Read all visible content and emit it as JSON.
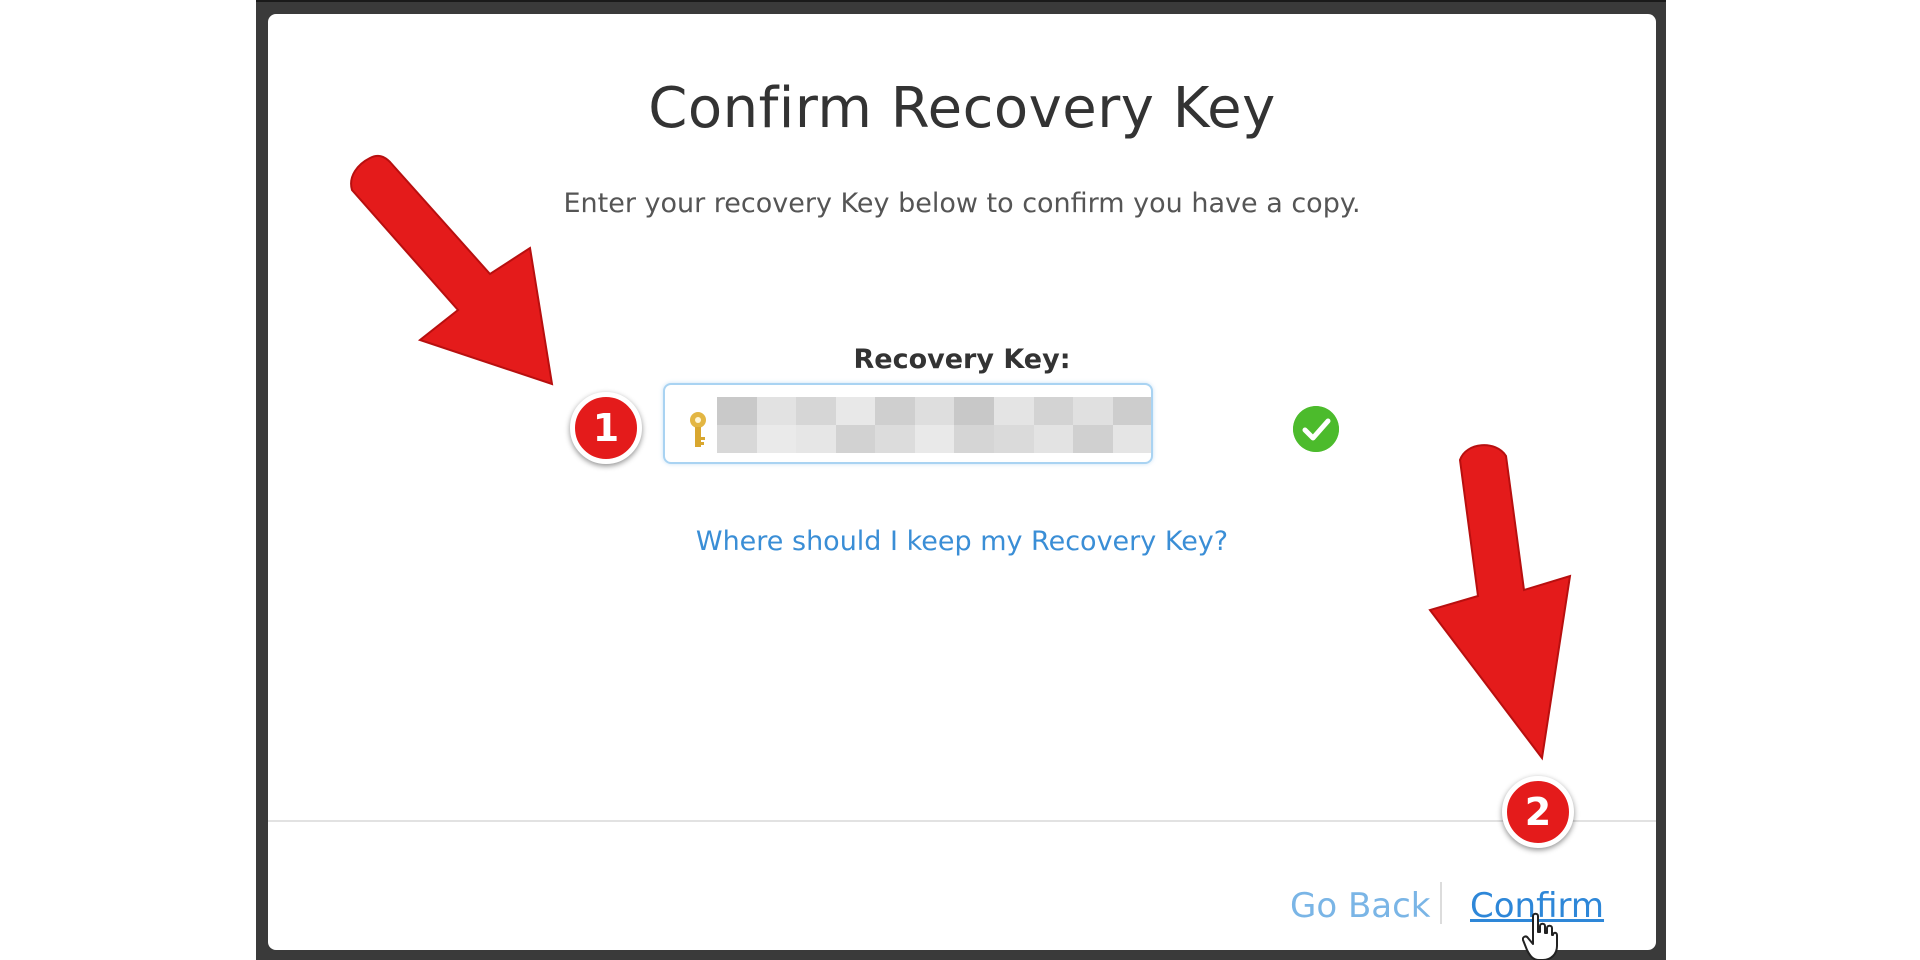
{
  "dialog": {
    "title": "Confirm Recovery Key",
    "subtitle": "Enter your recovery Key below to confirm you have a copy.",
    "field_label": "Recovery Key:",
    "key_icon": "key-icon",
    "valid_icon": "checkmark-icon",
    "help_link": "Where should I keep my Recovery Key?"
  },
  "footer": {
    "back_label": "Go Back",
    "confirm_label": "Confirm",
    "cursor_icon": "hand-pointer-icon"
  },
  "annotations": {
    "step1": "1",
    "step2": "2"
  },
  "colors": {
    "link": "#3a8ed6",
    "confirm": "#2e87d8",
    "arrow": "#e41b1b",
    "valid": "#4cbb2c"
  }
}
